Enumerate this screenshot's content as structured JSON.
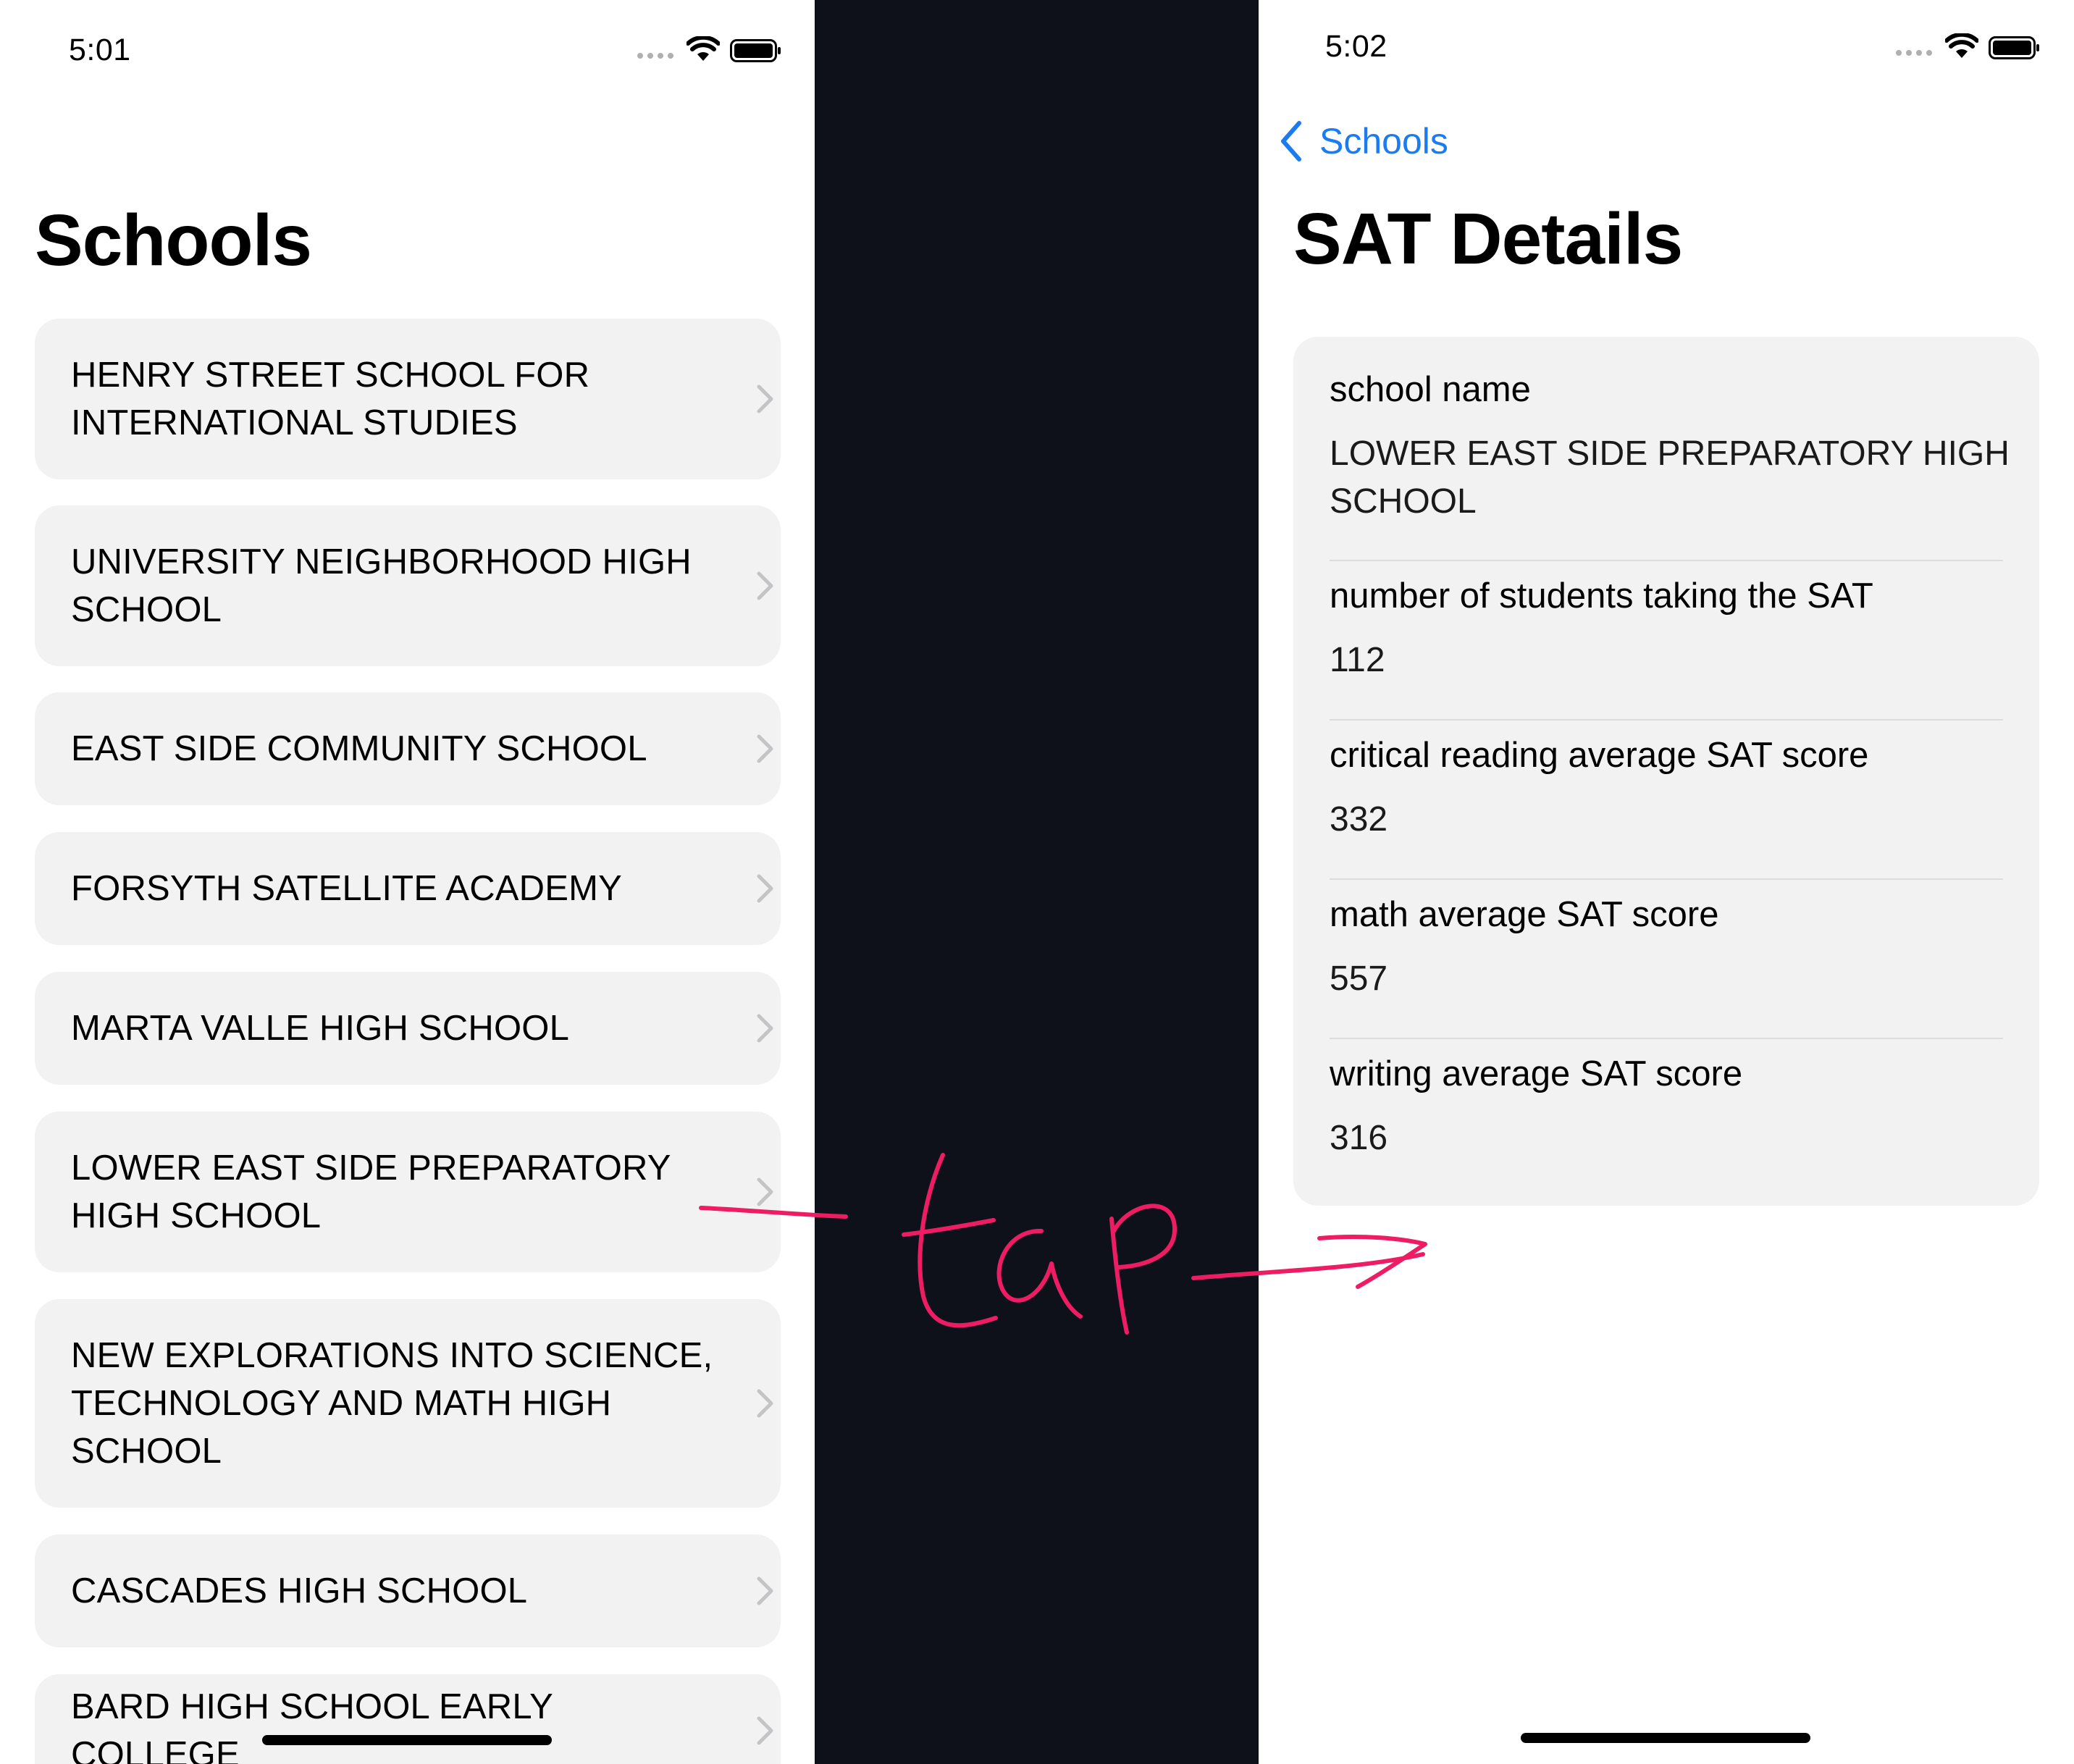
{
  "left": {
    "status_time": "5:01",
    "title": "Schools",
    "schools": [
      {
        "name": "HENRY STREET SCHOOL FOR INTERNATIONAL STUDIES"
      },
      {
        "name": "UNIVERSITY NEIGHBORHOOD HIGH SCHOOL"
      },
      {
        "name": "EAST SIDE COMMUNITY SCHOOL"
      },
      {
        "name": "FORSYTH SATELLITE ACADEMY"
      },
      {
        "name": "MARTA VALLE HIGH SCHOOL"
      },
      {
        "name": "LOWER EAST SIDE PREPARATORY HIGH SCHOOL"
      },
      {
        "name": "NEW EXPLORATIONS INTO SCIENCE, TECHNOLOGY AND MATH HIGH SCHOOL"
      },
      {
        "name": "CASCADES HIGH SCHOOL"
      },
      {
        "name": "BARD HIGH SCHOOL EARLY COLLEGE"
      }
    ]
  },
  "right": {
    "status_time": "5:02",
    "back_label": "Schools",
    "title": "SAT Details",
    "fields": [
      {
        "label": "school name",
        "value": "LOWER EAST SIDE PREPARATORY HIGH SCHOOL"
      },
      {
        "label": "number of students taking the SAT",
        "value": "112"
      },
      {
        "label": "critical reading average SAT score",
        "value": "332"
      },
      {
        "label": "math average SAT score",
        "value": "557"
      },
      {
        "label": "writing average SAT score",
        "value": "316"
      }
    ]
  },
  "annotation": {
    "text": "tap",
    "color": "#ee1d63"
  },
  "colors": {
    "accent": "#1b7cf2",
    "row_bg": "#f2f2f2",
    "divider": "#0e111a"
  }
}
